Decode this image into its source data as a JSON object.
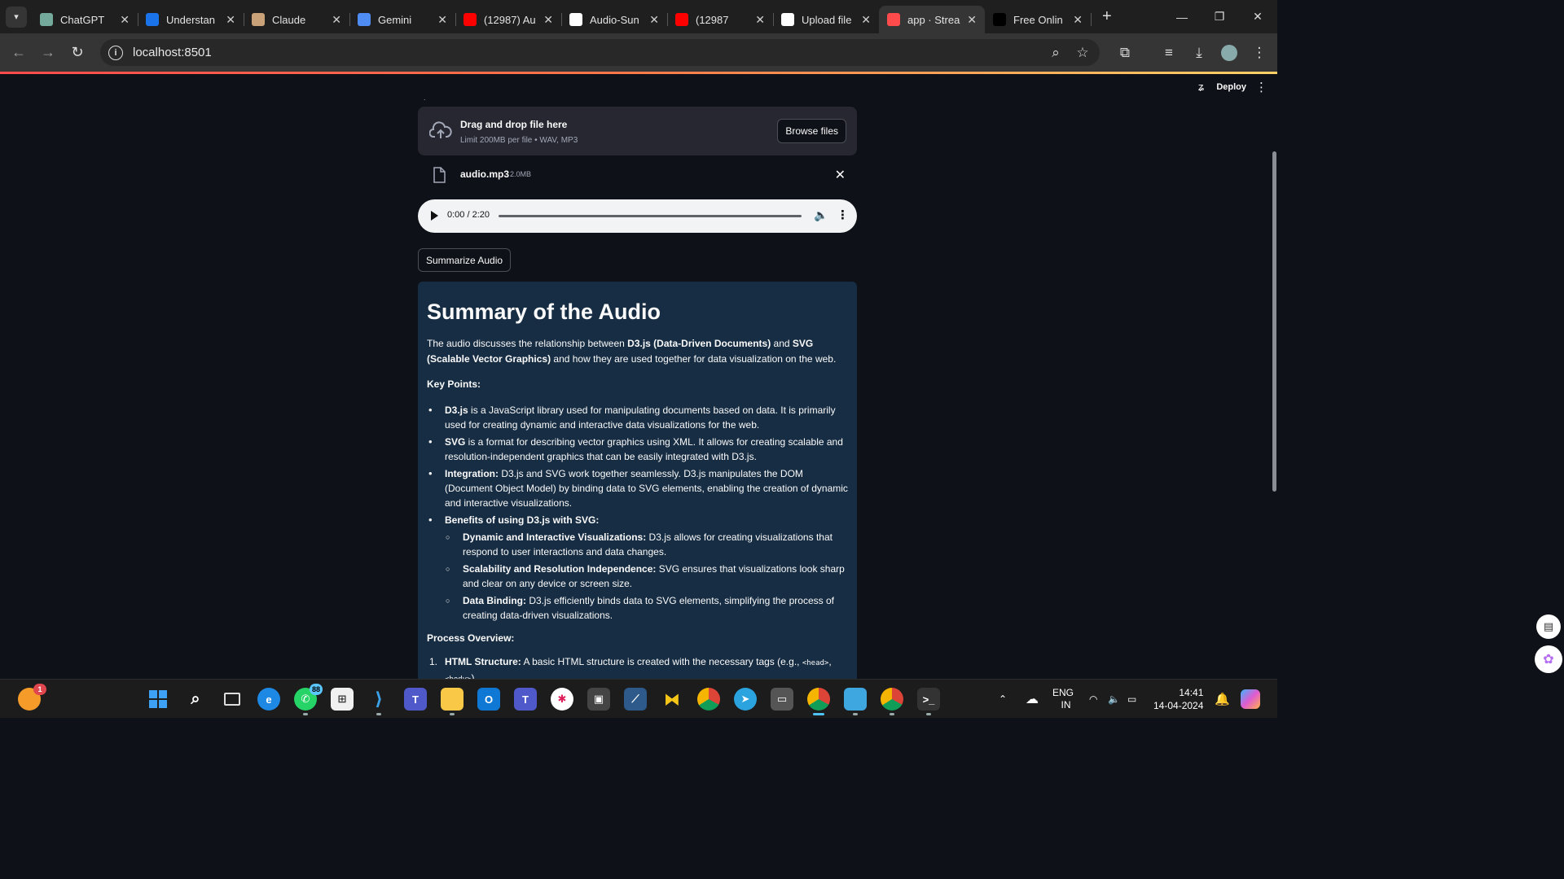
{
  "browser": {
    "tabs": [
      {
        "title": "ChatGPT",
        "icon": "chatgpt-icon",
        "color": "#74aa9c"
      },
      {
        "title": "Understan",
        "icon": "video-icon",
        "color": "#1a73e8"
      },
      {
        "title": "Claude",
        "icon": "claude-icon",
        "color": "#c9a27a"
      },
      {
        "title": "Gemini",
        "icon": "gemini-icon",
        "color": "#4f8df5"
      },
      {
        "title": "(12987) Au",
        "icon": "youtube-icon",
        "color": "#ff0000"
      },
      {
        "title": "Audio-Sun",
        "icon": "github-icon",
        "color": "#ffffff"
      },
      {
        "title": "(12987",
        "icon": "youtube-icon",
        "color": "#ff0000"
      },
      {
        "title": "Upload file",
        "icon": "github-icon",
        "color": "#ffffff"
      },
      {
        "title": "app · Strea",
        "icon": "streamlit-icon",
        "color": "#ff4b4b"
      },
      {
        "title": "Free Onlin",
        "icon": "r-icon",
        "color": "#000000"
      }
    ],
    "url": "localhost:8501"
  },
  "header": {
    "deploy_label": "Deploy",
    "running_glyph": "ʑ"
  },
  "uploader": {
    "title": "Drag and drop file here",
    "limit": "Limit 200MB per file • WAV, MP3",
    "browse_label": "Browse files"
  },
  "file": {
    "name": "audio.mp3",
    "size": "2.0MB"
  },
  "audio_player": {
    "time": "0:00 / 2:20",
    "progress": 0
  },
  "summarize_button": "Summarize Audio",
  "summary": {
    "heading": "Summary of the Audio",
    "intro_pre": "The audio discusses the relationship between ",
    "intro_b1": "D3.js (Data-Driven Documents)",
    "intro_mid": " and ",
    "intro_b2": "SVG (Scalable Vector Graphics)",
    "intro_post": " and how they are used together for data visualization on the web.",
    "key_points_label": "Key Points:",
    "points": [
      {
        "b": "D3.js",
        "t": " is a JavaScript library used for manipulating documents based on data. It is primarily used for creating dynamic and interactive data visualizations for the web."
      },
      {
        "b": "SVG",
        "t": " is a format for describing vector graphics using XML. It allows for creating scalable and resolution-independent graphics that can be easily integrated with D3.js."
      },
      {
        "b": "Integration:",
        "t": " D3.js and SVG work together seamlessly. D3.js manipulates the DOM (Document Object Model) by binding data to SVG elements, enabling the creation of dynamic and interactive visualizations."
      },
      {
        "b": "Benefits of using D3.js with SVG:",
        "t": ""
      }
    ],
    "benefits": [
      {
        "b": "Dynamic and Interactive Visualizations:",
        "t": " D3.js allows for creating visualizations that respond to user interactions and data changes."
      },
      {
        "b": "Scalability and Resolution Independence:",
        "t": " SVG ensures that visualizations look sharp and clear on any device or screen size."
      },
      {
        "b": "Data Binding:",
        "t": " D3.js efficiently binds data to SVG elements, simplifying the process of creating data-driven visualizations."
      }
    ],
    "process_label": "Process Overview:",
    "process": [
      {
        "n": "1.",
        "b": "HTML Structure:",
        "t": " A basic HTML structure is created with the necessary tags (e.g., ",
        "c1": "<head>",
        "sep": ", ",
        "c2": "<body>",
        "end": ")."
      }
    ]
  },
  "taskbar": {
    "lang_line1": "ENG",
    "lang_line2": "IN",
    "time": "14:41",
    "date": "14-04-2024",
    "notif_count": "1",
    "whatsapp_badge": "88"
  }
}
